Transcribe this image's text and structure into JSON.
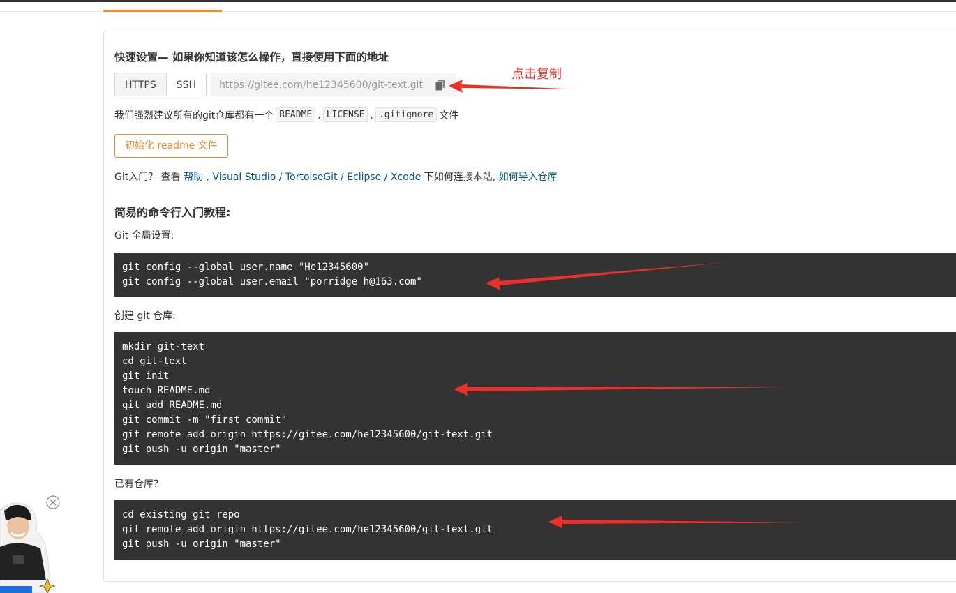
{
  "quick_setup": {
    "title": "快速设置— 如果你知道该怎么操作，直接使用下面的地址",
    "protocols": [
      "HTTPS",
      "SSH"
    ],
    "repo_url": "https://gitee.com/he12345600/git-text.git",
    "copy_icon": "copy-icon"
  },
  "annotation": {
    "copy_hint": "点击复制"
  },
  "recommend": {
    "prefix": "我们强烈建议所有的git仓库都有一个",
    "files": [
      "README",
      "LICENSE",
      ".gitignore"
    ],
    "sep": ",",
    "suffix": "文件"
  },
  "init_button": "初始化 readme 文件",
  "git_intro": {
    "prefix": "Git入门？ 查看 ",
    "help": "帮助",
    "comma": " , ",
    "visual_studio": "Visual Studio",
    "slash": " / ",
    "tortoisegit": "TortoiseGit",
    "eclipse": "Eclipse",
    "xcode": "Xcode",
    "middle": " 下如何连接本站, ",
    "import": "如何导入仓库"
  },
  "tutorial": {
    "heading": "简易的命令行入门教程:",
    "global_label": "Git 全局设置:",
    "global_code": [
      "git config --global user.name \"He12345600\"",
      "git config --global user.email \"porridge_h@163.com\""
    ],
    "create_label": "创建 git 仓库:",
    "create_code": [
      "mkdir git-text",
      "cd git-text",
      "git init",
      "touch README.md",
      "git add README.md",
      "git commit -m \"first commit\"",
      "git remote add origin https://gitee.com/he12345600/git-text.git",
      "git push -u origin \"master\""
    ],
    "existing_label": "已有仓库?",
    "existing_code": [
      "cd existing_git_repo",
      "git remote add origin https://gitee.com/he12345600/git-text.git",
      "git push -u origin \"master\""
    ]
  },
  "colors": {
    "accent": "#f0892f",
    "link": "#005980",
    "code_bg": "#333333",
    "annotation_red": "#e8312a"
  }
}
